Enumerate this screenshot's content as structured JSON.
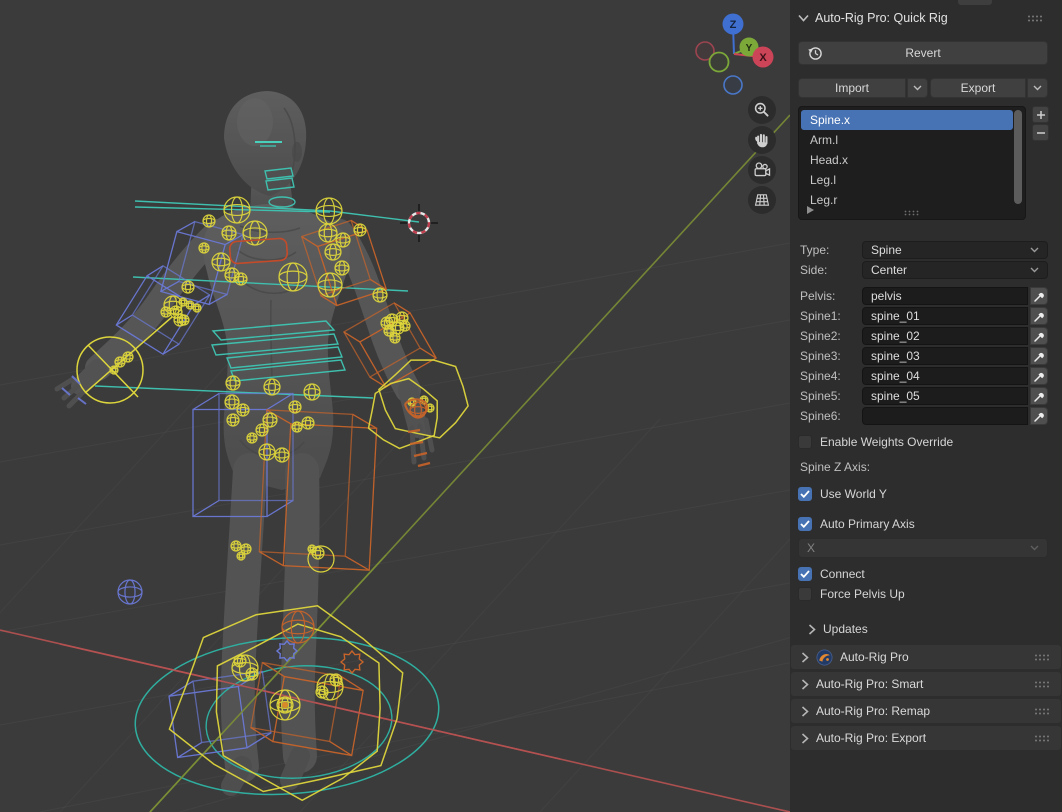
{
  "viewport": {
    "gizmo": {
      "x_label": "X",
      "y_label": "Y",
      "z_label": "Z"
    },
    "controls": [
      {
        "icon": "zoom-in-icon"
      },
      {
        "icon": "pan-hand-icon"
      },
      {
        "icon": "camera-icon"
      },
      {
        "icon": "perspective-grid-icon"
      }
    ]
  },
  "panel": {
    "title": "Auto-Rig Pro: Quick Rig",
    "revert_label": "Revert",
    "import_label": "Import",
    "export_label": "Export",
    "list": {
      "items": [
        "Spine.x",
        "Arm.l",
        "Head.x",
        "Leg.l",
        "Leg.r"
      ],
      "selected": "Spine.x",
      "add_icon": "plus-icon",
      "remove_icon": "minus-icon"
    },
    "type_row": {
      "label": "Type:",
      "value": "Spine"
    },
    "side_row": {
      "label": "Side:",
      "value": "Center"
    },
    "bones": [
      {
        "label": "Pelvis:",
        "value": "pelvis"
      },
      {
        "label": "Spine1:",
        "value": "spine_01"
      },
      {
        "label": "Spine2:",
        "value": "spine_02"
      },
      {
        "label": "Spine3:",
        "value": "spine_03"
      },
      {
        "label": "Spine4:",
        "value": "spine_04"
      },
      {
        "label": "Spine5:",
        "value": "spine_05"
      },
      {
        "label": "Spine6:",
        "value": ""
      }
    ],
    "toggles": [
      {
        "label": "Enable Weights Override",
        "checked": false
      },
      {
        "label": "Use World Y",
        "checked": true
      },
      {
        "label": "Auto Primary Axis",
        "checked": true
      },
      {
        "label": "Connect",
        "checked": true
      },
      {
        "label": "Force Pelvis Up",
        "checked": false
      }
    ],
    "spine_z_axis_label": "Spine Z Axis:",
    "axis_dropdown_value": "X",
    "updates_label": "Updates",
    "collapsed_panels": [
      {
        "label": "Auto-Rig Pro",
        "has_logo": true
      },
      {
        "label": "Auto-Rig Pro: Smart",
        "has_logo": false
      },
      {
        "label": "Auto-Rig Pro: Remap",
        "has_logo": false
      },
      {
        "label": "Auto-Rig Pro: Export",
        "has_logo": false
      }
    ],
    "colors": {
      "selection_blue": "#4772b3",
      "panel_bg": "#2d2d2d",
      "viewport_bg": "#3b3b3b",
      "rig_yellow": "#ddd53c",
      "rig_cyan": "#3fbfae",
      "rig_blue": "#6b79d6",
      "rig_orange": "#c8642a",
      "axis_green": "#7b8f35",
      "axis_red": "#b85252"
    }
  }
}
